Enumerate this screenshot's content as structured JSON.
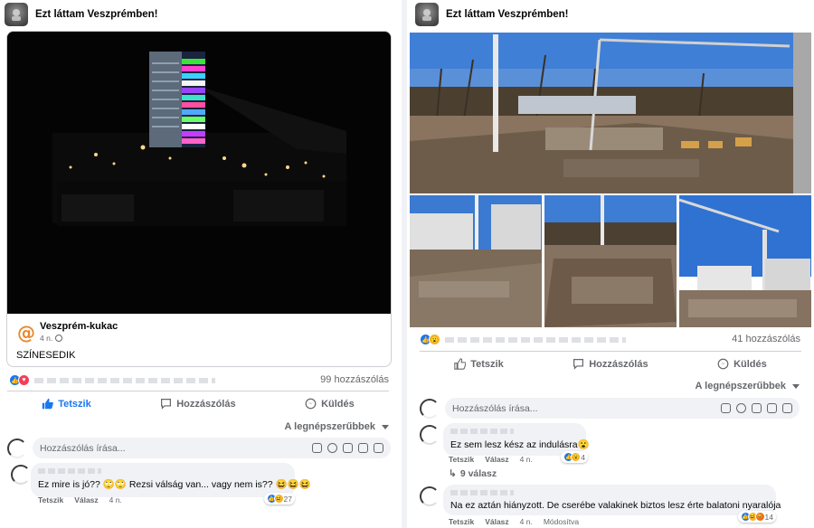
{
  "left_post": {
    "group_name": "Ezt láttam Veszprémben!",
    "shared": {
      "page_name": "Veszprém-kukac",
      "time": "4 n.",
      "text": "SZÍNESEDIK"
    },
    "reaction_count_label": "99 hozzászólás",
    "actions": {
      "like": "Tetszik",
      "comment": "Hozzászólás",
      "send": "Küldés"
    },
    "sort_label": "A legnépszerűbbek",
    "composer_placeholder": "Hozzászólás írása...",
    "comments": [
      {
        "text": "Ez mire is jó?? 🙄🙄 Rezsi válság van... vagy nem is?? 😆😆😆",
        "reaction_count": "27",
        "like_label": "Tetszik",
        "reply_label": "Válasz",
        "time": "4 n."
      }
    ]
  },
  "right_post": {
    "group_name": "Ezt láttam Veszprémben!",
    "reaction_count_label": "41 hozzászólás",
    "actions": {
      "like": "Tetszik",
      "comment": "Hozzászólás",
      "send": "Küldés"
    },
    "sort_label": "A legnépszerűbbek",
    "composer_placeholder": "Hozzászólás írása...",
    "comments": [
      {
        "text": "Ez sem lesz kész az indulásra😮",
        "reaction_count": "4",
        "like_label": "Tetszik",
        "reply_label": "Válasz",
        "time": "4 n.",
        "replies_label": "9 válasz"
      },
      {
        "text": "Na ez aztán hiányzott. De cserébe valakinek biztos lesz érte balatoni nyaralója",
        "reaction_count": "14",
        "like_label": "Tetszik",
        "reply_label": "Válasz",
        "time": "4 n.",
        "edited_label": "Módosítva"
      }
    ]
  },
  "colors": {
    "facebook_blue": "#1877f2",
    "text_secondary": "#65676b",
    "bubble_bg": "#f0f2f5",
    "divider": "#ced0d4"
  },
  "icons": [
    "group-avatar-icon",
    "globe-icon",
    "like-icon",
    "comment-icon",
    "messenger-icon",
    "caret-down-icon",
    "sticker-icon",
    "emoji-icon",
    "camera-icon",
    "gif-icon",
    "reply-arrow-icon"
  ]
}
